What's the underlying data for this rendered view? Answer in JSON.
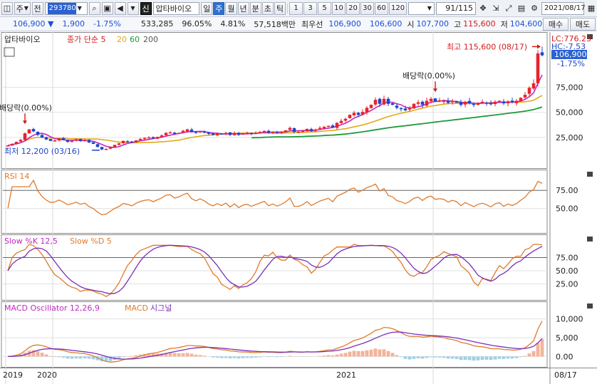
{
  "toolbar": {
    "market": "주",
    "prefix": "전",
    "code": "293780",
    "stock_badge": "신",
    "stock_name": "압타바이오",
    "periods": [
      "일",
      "주",
      "월",
      "년",
      "분",
      "초",
      "틱"
    ],
    "selected_period": "주",
    "intervals": [
      "1",
      "3",
      "5",
      "10",
      "20",
      "30",
      "60",
      "120"
    ],
    "page": "91",
    "page_total": "/115",
    "date": "2021/08/17"
  },
  "quote": {
    "price": "106,900",
    "change": "1,900",
    "change_pct": "-1.75%",
    "volume": "533,285",
    "vol_ratio": "96.05%",
    "turnover": "4.81%",
    "amount": "57,518백만",
    "best_ask_label": "최우선",
    "best_ask": "106,900",
    "best_bid": "106,600",
    "open_label": "시",
    "open": "107,700",
    "high_label": "고",
    "high": "115,600",
    "low_label": "저",
    "low": "104,600",
    "btn_sell": "매수",
    "btn_buy": "매도"
  },
  "colors": {
    "up": "#e8232c",
    "down": "#1d45c9",
    "ma5": "#c229c2",
    "ma20": "#e3a917",
    "ma60": "#1f9a3a",
    "rsi": "#e07a2a",
    "stoch_k": "#e07a2a",
    "stoch_d": "#7a2fb8",
    "macd": "#e07a2a",
    "signal": "#7a2fb8",
    "osc_pos": "#f2b49a",
    "osc_neg": "#9dd0e8"
  },
  "chart_data": [
    {
      "type": "candlestick",
      "title": "압타바이오",
      "legend": [
        "종가 단순 5",
        "20",
        "60",
        "200"
      ],
      "price_axis": [
        "75,000",
        "50,000",
        "25,000"
      ],
      "current_price_tag": "106,900",
      "current_change_tag": "-1.75%",
      "lc_label": "LC:776.23",
      "hc_label": "HC:-7.53",
      "high_annotation": "최고 115,600 (08/17)",
      "low_annotation": "최저 12,200 (03/16)",
      "dividend_annotations": [
        "배당락(0.00%)",
        "배당락(0.00%)"
      ],
      "x_labels": [
        "2019",
        "2020",
        "2021",
        "08/17"
      ],
      "ylim": [
        0,
        123000
      ],
      "close": [
        17000,
        18500,
        20500,
        22500,
        29000,
        33000,
        31000,
        27500,
        25000,
        23000,
        21500,
        22000,
        24000,
        22500,
        20500,
        21500,
        23000,
        21500,
        22500,
        20000,
        18500,
        15500,
        13000,
        13500,
        15500,
        17500,
        19000,
        21500,
        21000,
        20000,
        22000,
        23500,
        24500,
        25000,
        24000,
        25500,
        27000,
        29500,
        30000,
        28500,
        29500,
        31500,
        33000,
        30500,
        29500,
        31000,
        30000,
        28500,
        27500,
        29000,
        28000,
        29500,
        27500,
        29500,
        27500,
        29000,
        29500,
        28500,
        29500,
        30500,
        31500,
        29500,
        30500,
        29500,
        30500,
        32000,
        34500,
        30500,
        30500,
        31500,
        33500,
        31500,
        33000,
        34500,
        35500,
        36500,
        35000,
        39500,
        41500,
        43500,
        47500,
        49500,
        47500,
        50500,
        54500,
        57500,
        62500,
        58500,
        63500,
        58500,
        57500,
        54500,
        53500,
        52000,
        54500,
        58500,
        60000,
        57500,
        61500,
        63500,
        61000,
        62000,
        61500,
        59500,
        61500,
        60500,
        57500,
        60500,
        59000,
        57500,
        59500,
        60500,
        59500,
        58000,
        60500,
        61500,
        59000,
        61000,
        60000,
        61500,
        64500,
        67500,
        74500,
        79000,
        108800,
        106900
      ],
      "high_annotation_value": 115600,
      "low_annotation_value": 12200
    },
    {
      "type": "line",
      "title": "RSI 14",
      "series": [
        {
          "name": "RSI 14"
        }
      ],
      "levels": [
        "75.00",
        "50.00"
      ],
      "ylim": [
        20,
        90
      ]
    },
    {
      "type": "line",
      "title": "Slow %K 12,5",
      "series": [
        {
          "name": "Slow %K 12,5"
        },
        {
          "name": "Slow %D 5"
        }
      ],
      "levels": [
        "75.00",
        "50.00",
        "25.00"
      ],
      "ylim": [
        0,
        100
      ]
    },
    {
      "type": "line",
      "title": "MACD Oscillator 12,26,9",
      "series": [
        {
          "name": "MACD Oscillator 12,26,9"
        },
        {
          "name": "MACD"
        },
        {
          "name": "시그널"
        }
      ],
      "levels": [
        "10,000",
        "5,000",
        "0.00"
      ],
      "ylim": [
        -2000,
        12000
      ]
    }
  ]
}
